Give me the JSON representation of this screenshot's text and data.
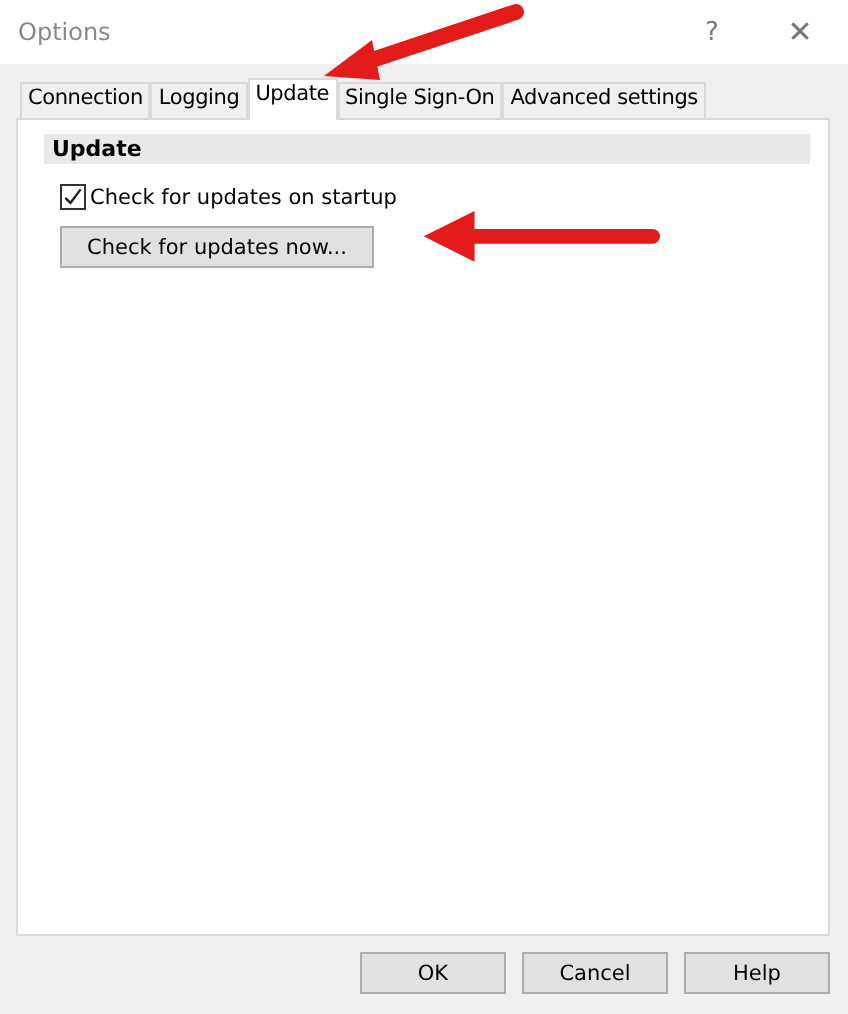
{
  "window": {
    "title": "Options",
    "help": "?",
    "close": "✕"
  },
  "tabs": [
    {
      "label": "Connection",
      "selected": false
    },
    {
      "label": "Logging",
      "selected": false
    },
    {
      "label": "Update",
      "selected": true
    },
    {
      "label": "Single Sign-On",
      "selected": false
    },
    {
      "label": "Advanced settings",
      "selected": false
    }
  ],
  "section": {
    "title": "Update"
  },
  "checkbox": {
    "label": "Check for updates on startup",
    "checked": true
  },
  "action_button": "Check for updates now...",
  "annotations": [
    {
      "kind": "arrow"
    },
    {
      "kind": "arrow"
    }
  ],
  "buttons": [
    "OK",
    "Cancel",
    "Help"
  ]
}
